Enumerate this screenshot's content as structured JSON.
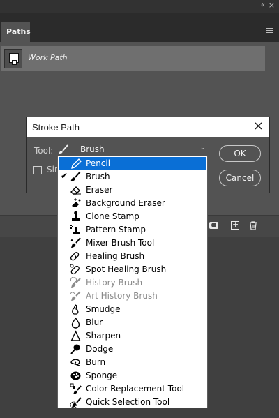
{
  "panel": {
    "tab_label": "Paths",
    "collapse_label": "«",
    "close_label": "×",
    "work_path": "Work Path"
  },
  "dialog": {
    "title": "Stroke Path",
    "close_label": "×",
    "tool_label": "Tool:",
    "selected_tool": "Brush",
    "simulate_label_partial": "Sin",
    "ok_label": "OK",
    "cancel_label": "Cancel"
  },
  "dropdown": {
    "highlighted": "Pencil",
    "checked": "Brush",
    "items": [
      {
        "label": "Pencil",
        "icon": "pencil-icon",
        "state": "highlighted"
      },
      {
        "label": "Brush",
        "icon": "brush-icon",
        "state": "checked"
      },
      {
        "label": "Eraser",
        "icon": "eraser-icon",
        "state": "normal"
      },
      {
        "label": "Background Eraser",
        "icon": "background-eraser-icon",
        "state": "normal"
      },
      {
        "label": "Clone Stamp",
        "icon": "clone-stamp-icon",
        "state": "normal"
      },
      {
        "label": "Pattern Stamp",
        "icon": "pattern-stamp-icon",
        "state": "normal"
      },
      {
        "label": "Mixer Brush Tool",
        "icon": "mixer-brush-icon",
        "state": "normal"
      },
      {
        "label": "Healing Brush",
        "icon": "healing-brush-icon",
        "state": "normal"
      },
      {
        "label": "Spot Healing Brush",
        "icon": "spot-healing-brush-icon",
        "state": "normal"
      },
      {
        "label": "History Brush",
        "icon": "history-brush-icon",
        "state": "disabled"
      },
      {
        "label": "Art History Brush",
        "icon": "art-history-brush-icon",
        "state": "disabled"
      },
      {
        "label": "Smudge",
        "icon": "smudge-icon",
        "state": "normal"
      },
      {
        "label": "Blur",
        "icon": "blur-icon",
        "state": "normal"
      },
      {
        "label": "Sharpen",
        "icon": "sharpen-icon",
        "state": "normal"
      },
      {
        "label": "Dodge",
        "icon": "dodge-icon",
        "state": "normal"
      },
      {
        "label": "Burn",
        "icon": "burn-icon",
        "state": "normal"
      },
      {
        "label": "Sponge",
        "icon": "sponge-icon",
        "state": "normal"
      },
      {
        "label": "Color Replacement Tool",
        "icon": "color-replacement-icon",
        "state": "normal"
      },
      {
        "label": "Quick Selection Tool",
        "icon": "quick-selection-icon",
        "state": "normal"
      }
    ]
  },
  "colors": {
    "highlight": "#0a6fd6",
    "panel_bg": "#535353",
    "disabled_text": "#8a8a8a"
  }
}
